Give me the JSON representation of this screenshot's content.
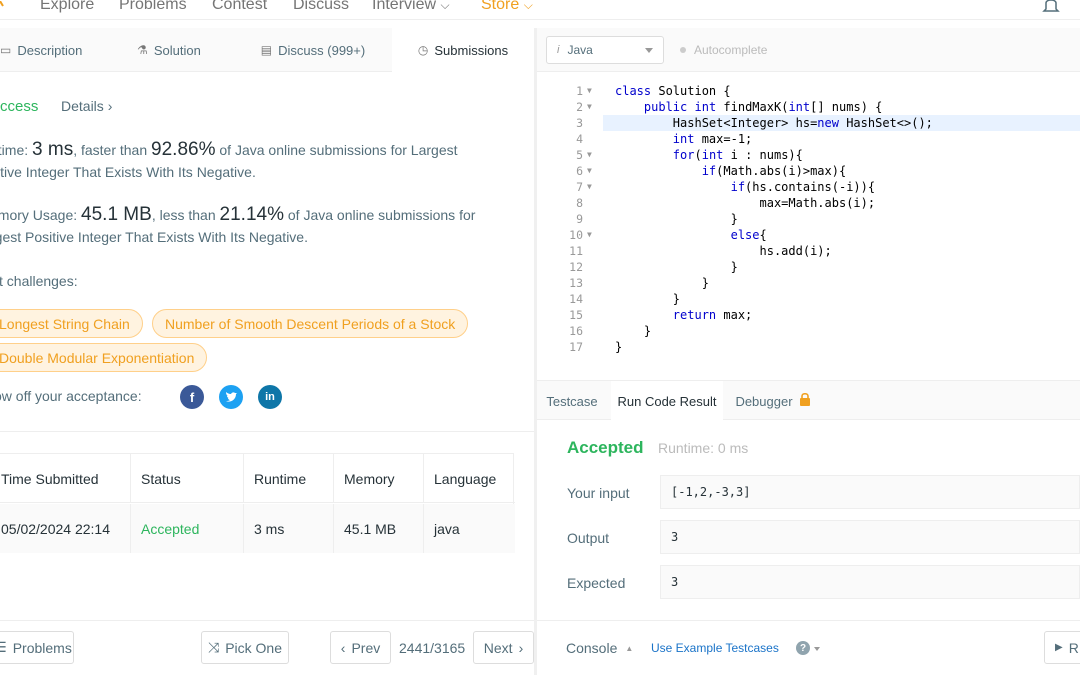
{
  "nav": {
    "items": [
      "Explore",
      "Problems",
      "Contest",
      "Discuss",
      "Interview",
      "Store"
    ],
    "accent": "#f0a020"
  },
  "tabs": [
    "Description",
    "Solution",
    "Discuss (999+)",
    "Submissions"
  ],
  "result": {
    "status": "ccess",
    "details_label": "Details"
  },
  "runtime_para": {
    "label": "ntime:",
    "value": "3 ms",
    "faster_than": ", faster than",
    "percent": "92.86%",
    "suffix": "of Java online submissions for Largest",
    "line2": "sitive Integer That Exists With Its Negative."
  },
  "memory_para": {
    "label": "emory Usage:",
    "value": "45.1 MB",
    "less_than": ", less than",
    "percent": "21.14%",
    "suffix": "of Java online submissions for",
    "line2": "rgest Positive Integer That Exists With Its Negative."
  },
  "next_challenges": {
    "label": "xt challenges:",
    "items": [
      "Longest String Chain",
      "Number of Smooth Descent Periods of a Stock",
      "Double Modular Exponentiation"
    ]
  },
  "share": {
    "label": "ow off your acceptance:",
    "icons": [
      "facebook-icon",
      "twitter-icon",
      "linkedin-icon"
    ]
  },
  "submissions_table": {
    "headers": [
      "Time Submitted",
      "Status",
      "Runtime",
      "Memory",
      "Language"
    ],
    "rows": [
      [
        "05/02/2024 22:14",
        "Accepted",
        "3 ms",
        "45.1 MB",
        "java"
      ]
    ]
  },
  "bottom_left": {
    "problems": "Problems",
    "pick_one": "Pick One",
    "prev": "Prev",
    "pager": "2441/3165",
    "next": "Next"
  },
  "editor": {
    "language": "Java",
    "autocomplete": "Autocomplete",
    "lines": [
      "class Solution {",
      "    public int findMaxK(int[] nums) {",
      "        HashSet<Integer> hs=new HashSet<>();",
      "        int max=-1;",
      "        for(int i : nums){",
      "            if(Math.abs(i)>max){",
      "                if(hs.contains(-i)){",
      "                    max=Math.abs(i);",
      "                }",
      "                else{",
      "                    hs.add(i);",
      "                }",
      "            }",
      "        }",
      "        return max;",
      "    }",
      "}"
    ]
  },
  "result_tabs": [
    "Testcase",
    "Run Code Result",
    "Debugger"
  ],
  "run_result": {
    "status": "Accepted",
    "runtime": "Runtime: 0 ms",
    "input_label": "Your input",
    "input": "[-1,2,-3,3]",
    "output_label": "Output",
    "output": "3",
    "expected_label": "Expected",
    "expected": "3"
  },
  "bottom_right": {
    "console": "Console",
    "example": "Use Example Testcases",
    "run": "R"
  }
}
